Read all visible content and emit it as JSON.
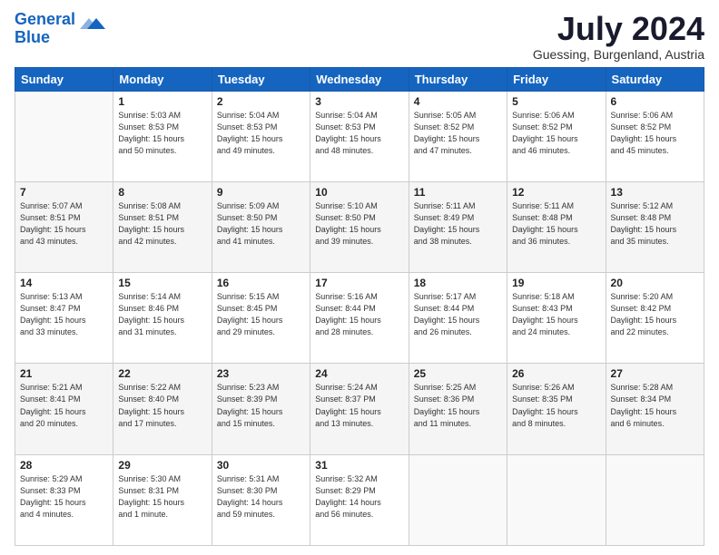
{
  "header": {
    "logo_line1": "General",
    "logo_line2": "Blue",
    "main_title": "July 2024",
    "subtitle": "Guessing, Burgenland, Austria"
  },
  "calendar": {
    "days_of_week": [
      "Sunday",
      "Monday",
      "Tuesday",
      "Wednesday",
      "Thursday",
      "Friday",
      "Saturday"
    ],
    "weeks": [
      [
        {
          "num": "",
          "detail": ""
        },
        {
          "num": "1",
          "detail": "Sunrise: 5:03 AM\nSunset: 8:53 PM\nDaylight: 15 hours\nand 50 minutes."
        },
        {
          "num": "2",
          "detail": "Sunrise: 5:04 AM\nSunset: 8:53 PM\nDaylight: 15 hours\nand 49 minutes."
        },
        {
          "num": "3",
          "detail": "Sunrise: 5:04 AM\nSunset: 8:53 PM\nDaylight: 15 hours\nand 48 minutes."
        },
        {
          "num": "4",
          "detail": "Sunrise: 5:05 AM\nSunset: 8:52 PM\nDaylight: 15 hours\nand 47 minutes."
        },
        {
          "num": "5",
          "detail": "Sunrise: 5:06 AM\nSunset: 8:52 PM\nDaylight: 15 hours\nand 46 minutes."
        },
        {
          "num": "6",
          "detail": "Sunrise: 5:06 AM\nSunset: 8:52 PM\nDaylight: 15 hours\nand 45 minutes."
        }
      ],
      [
        {
          "num": "7",
          "detail": "Sunrise: 5:07 AM\nSunset: 8:51 PM\nDaylight: 15 hours\nand 43 minutes."
        },
        {
          "num": "8",
          "detail": "Sunrise: 5:08 AM\nSunset: 8:51 PM\nDaylight: 15 hours\nand 42 minutes."
        },
        {
          "num": "9",
          "detail": "Sunrise: 5:09 AM\nSunset: 8:50 PM\nDaylight: 15 hours\nand 41 minutes."
        },
        {
          "num": "10",
          "detail": "Sunrise: 5:10 AM\nSunset: 8:50 PM\nDaylight: 15 hours\nand 39 minutes."
        },
        {
          "num": "11",
          "detail": "Sunrise: 5:11 AM\nSunset: 8:49 PM\nDaylight: 15 hours\nand 38 minutes."
        },
        {
          "num": "12",
          "detail": "Sunrise: 5:11 AM\nSunset: 8:48 PM\nDaylight: 15 hours\nand 36 minutes."
        },
        {
          "num": "13",
          "detail": "Sunrise: 5:12 AM\nSunset: 8:48 PM\nDaylight: 15 hours\nand 35 minutes."
        }
      ],
      [
        {
          "num": "14",
          "detail": "Sunrise: 5:13 AM\nSunset: 8:47 PM\nDaylight: 15 hours\nand 33 minutes."
        },
        {
          "num": "15",
          "detail": "Sunrise: 5:14 AM\nSunset: 8:46 PM\nDaylight: 15 hours\nand 31 minutes."
        },
        {
          "num": "16",
          "detail": "Sunrise: 5:15 AM\nSunset: 8:45 PM\nDaylight: 15 hours\nand 29 minutes."
        },
        {
          "num": "17",
          "detail": "Sunrise: 5:16 AM\nSunset: 8:44 PM\nDaylight: 15 hours\nand 28 minutes."
        },
        {
          "num": "18",
          "detail": "Sunrise: 5:17 AM\nSunset: 8:44 PM\nDaylight: 15 hours\nand 26 minutes."
        },
        {
          "num": "19",
          "detail": "Sunrise: 5:18 AM\nSunset: 8:43 PM\nDaylight: 15 hours\nand 24 minutes."
        },
        {
          "num": "20",
          "detail": "Sunrise: 5:20 AM\nSunset: 8:42 PM\nDaylight: 15 hours\nand 22 minutes."
        }
      ],
      [
        {
          "num": "21",
          "detail": "Sunrise: 5:21 AM\nSunset: 8:41 PM\nDaylight: 15 hours\nand 20 minutes."
        },
        {
          "num": "22",
          "detail": "Sunrise: 5:22 AM\nSunset: 8:40 PM\nDaylight: 15 hours\nand 17 minutes."
        },
        {
          "num": "23",
          "detail": "Sunrise: 5:23 AM\nSunset: 8:39 PM\nDaylight: 15 hours\nand 15 minutes."
        },
        {
          "num": "24",
          "detail": "Sunrise: 5:24 AM\nSunset: 8:37 PM\nDaylight: 15 hours\nand 13 minutes."
        },
        {
          "num": "25",
          "detail": "Sunrise: 5:25 AM\nSunset: 8:36 PM\nDaylight: 15 hours\nand 11 minutes."
        },
        {
          "num": "26",
          "detail": "Sunrise: 5:26 AM\nSunset: 8:35 PM\nDaylight: 15 hours\nand 8 minutes."
        },
        {
          "num": "27",
          "detail": "Sunrise: 5:28 AM\nSunset: 8:34 PM\nDaylight: 15 hours\nand 6 minutes."
        }
      ],
      [
        {
          "num": "28",
          "detail": "Sunrise: 5:29 AM\nSunset: 8:33 PM\nDaylight: 15 hours\nand 4 minutes."
        },
        {
          "num": "29",
          "detail": "Sunrise: 5:30 AM\nSunset: 8:31 PM\nDaylight: 15 hours\nand 1 minute."
        },
        {
          "num": "30",
          "detail": "Sunrise: 5:31 AM\nSunset: 8:30 PM\nDaylight: 14 hours\nand 59 minutes."
        },
        {
          "num": "31",
          "detail": "Sunrise: 5:32 AM\nSunset: 8:29 PM\nDaylight: 14 hours\nand 56 minutes."
        },
        {
          "num": "",
          "detail": ""
        },
        {
          "num": "",
          "detail": ""
        },
        {
          "num": "",
          "detail": ""
        }
      ]
    ]
  }
}
